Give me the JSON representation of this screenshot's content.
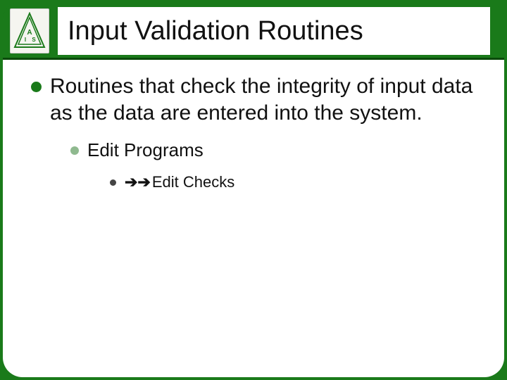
{
  "colors": {
    "brand_green": "#1a7a1a",
    "dark_green": "#0b4a0b",
    "light_green_bullet": "#8fb98f"
  },
  "logo": {
    "alt": "AIS Systems logo",
    "letters": "AIS"
  },
  "title": "Input Validation Routines",
  "bullets": {
    "lvl1": "Routines that check the integrity of input data as the data are entered into the system.",
    "lvl2": "Edit Programs",
    "lvl3_arrows": "➔➔",
    "lvl3": "Edit Checks"
  }
}
